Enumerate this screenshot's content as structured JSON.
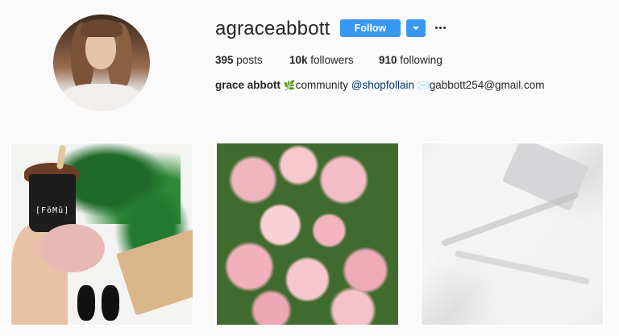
{
  "profile": {
    "username": "agraceabbott",
    "follow_label": "Follow",
    "more_icon": "ellipsis-icon",
    "dropdown_icon": "chevron-down-icon"
  },
  "stats": {
    "posts_count": "395",
    "posts_label": "posts",
    "followers_count": "10k",
    "followers_label": "followers",
    "following_count": "910",
    "following_label": "following"
  },
  "bio": {
    "name": "grace abbott",
    "leaf_glyph": "🌿",
    "community_text": "community",
    "mention": "@shopfollain",
    "envelope_glyph": "✉️",
    "email": "gabbott254@gmail.com"
  },
  "posts": [
    {
      "label": "[FōMū]",
      "subject": "ice-cream"
    },
    {
      "subject": "roses"
    },
    {
      "subject": "white-sheets"
    }
  ],
  "colors": {
    "accent": "#3897f0",
    "link": "#003569",
    "text": "#262626",
    "background": "#fafafa"
  }
}
